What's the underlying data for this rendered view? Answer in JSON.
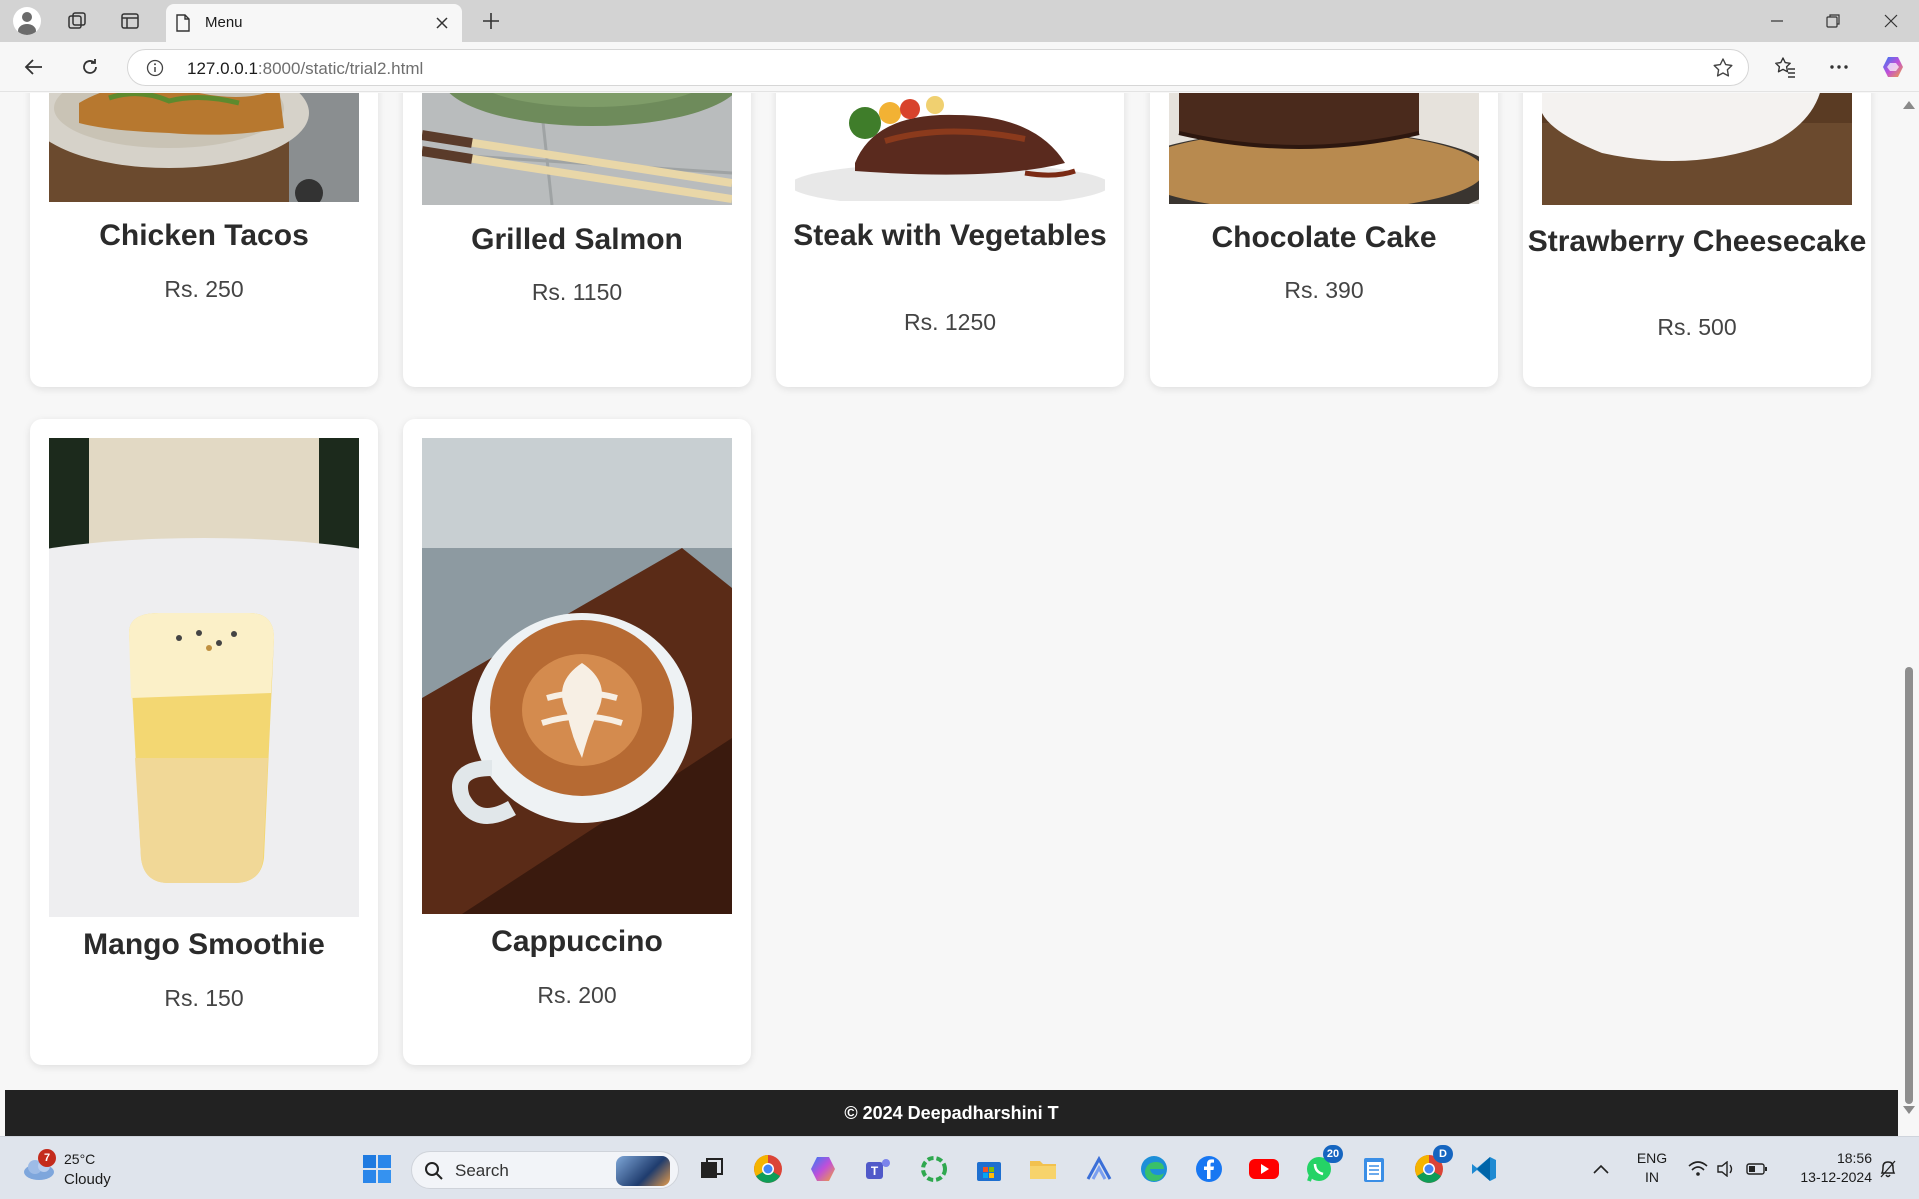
{
  "browser": {
    "tab_title": "Menu",
    "url_host": "127.0.0.1",
    "url_rest": ":8000/static/trial2.html"
  },
  "menu": {
    "items": [
      {
        "name": "Chicken Tacos",
        "price": "Rs. 250"
      },
      {
        "name": "Grilled Salmon",
        "price": "Rs. 1150"
      },
      {
        "name": "Steak with Vegetables",
        "price": "Rs. 1250"
      },
      {
        "name": "Chocolate Cake",
        "price": "Rs. 390"
      },
      {
        "name": "Strawberry Cheesecake",
        "price": "Rs. 500"
      },
      {
        "name": "Mango Smoothie",
        "price": "Rs. 150"
      },
      {
        "name": "Cappuccino",
        "price": "Rs. 200"
      }
    ]
  },
  "footer": {
    "text": "© 2024 Deepadharshini T"
  },
  "taskbar": {
    "weather_temp": "25°C",
    "weather_condition": "Cloudy",
    "weather_badge": "7",
    "search_label": "Search",
    "whatsapp_badge": "20",
    "chrome_profile_badge": "D",
    "language_line1": "ENG",
    "language_line2": "IN",
    "time": "18:56",
    "date": "13-12-2024"
  },
  "colors": {
    "footer_bg": "#222222",
    "page_bg": "#f7f7f7",
    "card_bg": "#ffffff"
  }
}
